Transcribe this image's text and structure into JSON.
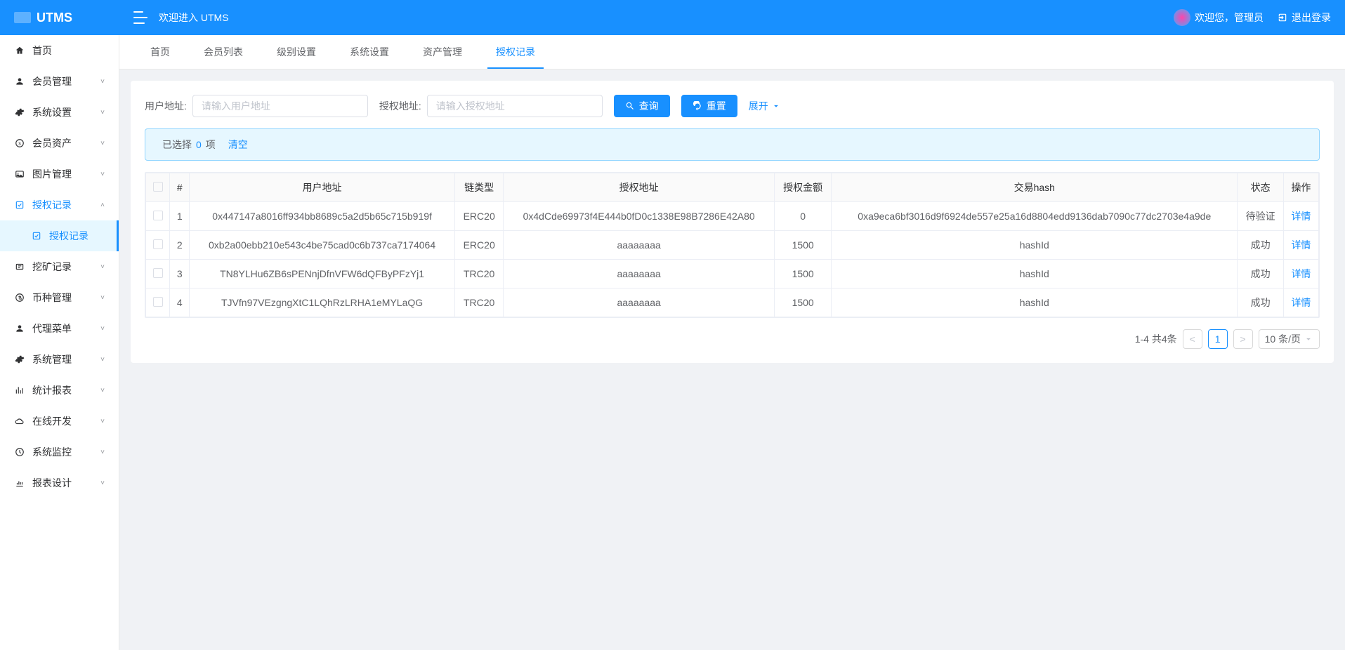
{
  "header": {
    "brand": "UTMS",
    "welcome": "欢迎进入 UTMS",
    "greeting": "欢迎您，管理员",
    "logout": "退出登录"
  },
  "sidebar": {
    "items": [
      {
        "icon": "home",
        "label": "首页",
        "expandable": false
      },
      {
        "icon": "user",
        "label": "会员管理",
        "expandable": true
      },
      {
        "icon": "gear",
        "label": "系统设置",
        "expandable": true
      },
      {
        "icon": "coin",
        "label": "会员资产",
        "expandable": true
      },
      {
        "icon": "image",
        "label": "图片管理",
        "expandable": true
      },
      {
        "icon": "auth",
        "label": "授权记录",
        "expandable": true,
        "active": true,
        "children": [
          {
            "label": "授权记录"
          }
        ]
      },
      {
        "icon": "dig",
        "label": "挖矿记录",
        "expandable": true
      },
      {
        "icon": "currency",
        "label": "币种管理",
        "expandable": true
      },
      {
        "icon": "user",
        "label": "代理菜单",
        "expandable": true
      },
      {
        "icon": "gear",
        "label": "系统管理",
        "expandable": true
      },
      {
        "icon": "chart",
        "label": "统计报表",
        "expandable": true
      },
      {
        "icon": "cloud",
        "label": "在线开发",
        "expandable": true
      },
      {
        "icon": "monitor",
        "label": "系统监控",
        "expandable": true
      },
      {
        "icon": "report",
        "label": "报表设计",
        "expandable": true
      }
    ]
  },
  "tabs": [
    {
      "label": "首页"
    },
    {
      "label": "会员列表"
    },
    {
      "label": "级别设置"
    },
    {
      "label": "系统设置"
    },
    {
      "label": "资产管理"
    },
    {
      "label": "授权记录",
      "active": true
    }
  ],
  "search": {
    "user_label": "用户地址:",
    "user_placeholder": "请输入用户地址",
    "auth_label": "授权地址:",
    "auth_placeholder": "请输入授权地址",
    "query_btn": "查询",
    "reset_btn": "重置",
    "expand": "展开"
  },
  "alert": {
    "prefix": "已选择",
    "count": "0",
    "suffix": "项",
    "clear": "清空"
  },
  "table": {
    "headers": [
      "#",
      "用户地址",
      "链类型",
      "授权地址",
      "授权金额",
      "交易hash",
      "状态",
      "操作"
    ],
    "rows": [
      {
        "idx": "1",
        "user": "0x447147a8016ff934bb8689c5a2d5b65c715b919f",
        "chain": "ERC20",
        "auth": "0x4dCde69973f4E444b0fD0c1338E98B7286E42A80",
        "amount": "0",
        "hash": "0xa9eca6bf3016d9f6924de557e25a16d8804edd9136dab7090c77dc2703e4a9de",
        "status": "待验证",
        "action": "详情"
      },
      {
        "idx": "2",
        "user": "0xb2a00ebb210e543c4be75cad0c6b737ca7174064",
        "chain": "ERC20",
        "auth": "aaaaaaaa",
        "amount": "1500",
        "hash": "hashId",
        "status": "成功",
        "action": "详情"
      },
      {
        "idx": "3",
        "user": "TN8YLHu6ZB6sPENnjDfnVFW6dQFByPFzYj1",
        "chain": "TRC20",
        "auth": "aaaaaaaa",
        "amount": "1500",
        "hash": "hashId",
        "status": "成功",
        "action": "详情"
      },
      {
        "idx": "4",
        "user": "TJVfn97VEzgngXtC1LQhRzLRHA1eMYLaQG",
        "chain": "TRC20",
        "auth": "aaaaaaaa",
        "amount": "1500",
        "hash": "hashId",
        "status": "成功",
        "action": "详情"
      }
    ]
  },
  "pagination": {
    "info": "1-4 共4条",
    "current": "1",
    "size": "10 条/页"
  }
}
